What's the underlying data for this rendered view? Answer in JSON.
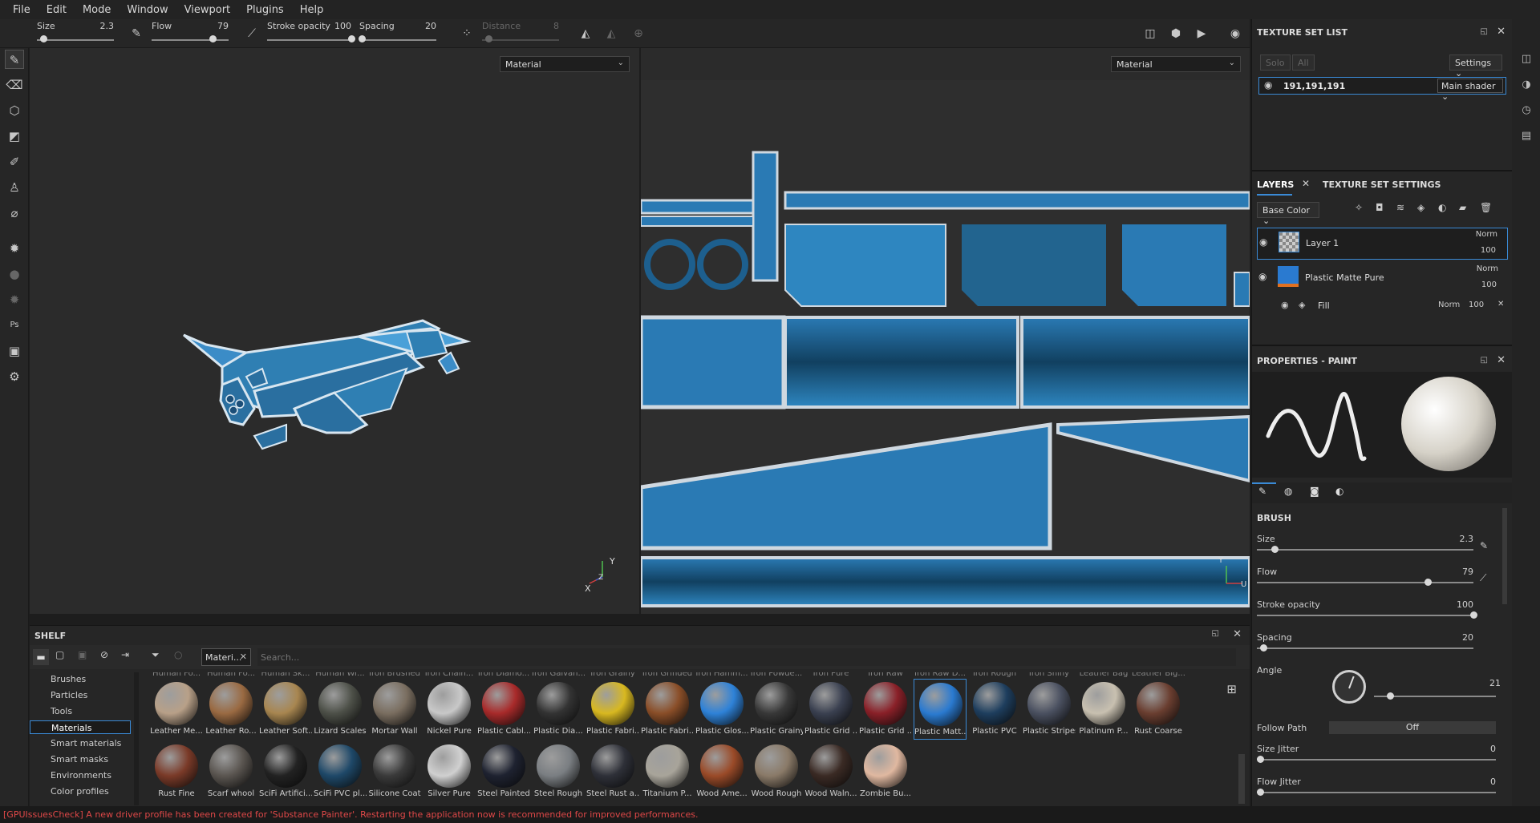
{
  "menu": [
    "File",
    "Edit",
    "Mode",
    "Window",
    "Viewport",
    "Plugins",
    "Help"
  ],
  "toolbar": {
    "size": {
      "label": "Size",
      "value": "2.3",
      "level": 0.08
    },
    "flow": {
      "label": "Flow",
      "value": "79",
      "level": 0.79
    },
    "stroke_opacity": {
      "label": "Stroke opacity",
      "value": "100",
      "level": 1.0
    },
    "spacing": {
      "label": "Spacing",
      "value": "20",
      "level": 0.03
    },
    "distance": {
      "label": "Distance",
      "value": "8",
      "level": 0.08
    }
  },
  "viewport3d": {
    "channel": "Material",
    "gizmo": {
      "y": "Y",
      "z": "Z",
      "x": "X"
    }
  },
  "viewport2d": {
    "channel": "Material",
    "gizmo": {
      "y": "Y",
      "x": "U"
    }
  },
  "shelf": {
    "title": "SHELF",
    "filter_tag": "Materi...",
    "search_placeholder": "Search...",
    "categories": [
      "Brushes",
      "Particles",
      "Tools",
      "Materials",
      "Smart materials",
      "Smart masks",
      "Environments",
      "Color profiles"
    ],
    "active_category": "Materials",
    "top_partial": [
      "Human Fo...",
      "Human Fo...",
      "Human Sk...",
      "Human Wr...",
      "Iron Brushed",
      "Iron Chain...",
      "Iron Diamo...",
      "Iron Galvan...",
      "Iron Grainy",
      "Iron Grinded",
      "Iron Hamm...",
      "Iron Powde...",
      "Iron Pure",
      "Iron Raw",
      "Iron Raw D...",
      "Iron Rough",
      "Iron Shiny",
      "Leather Bag",
      "Leather Big..."
    ],
    "row1": [
      {
        "name": "Leather Me...",
        "color": "#b8a088"
      },
      {
        "name": "Leather Ro...",
        "color": "#9a6a42"
      },
      {
        "name": "Leather Soft...",
        "color": "#a88650"
      },
      {
        "name": "Lizard Scales",
        "color": "#4d5048"
      },
      {
        "name": "Mortar Wall",
        "color": "#7a6e60"
      },
      {
        "name": "Nickel Pure",
        "color": "#c8c8c8"
      },
      {
        "name": "Plastic Cabl...",
        "color": "#a82a2a"
      },
      {
        "name": "Plastic Dia...",
        "color": "#333333"
      },
      {
        "name": "Plastic Fabri...",
        "color": "#d8b820"
      },
      {
        "name": "Plastic Fabri...",
        "color": "#8a4e28"
      },
      {
        "name": "Plastic Glos...",
        "color": "#2e82d8"
      },
      {
        "name": "Plastic Grainy",
        "color": "#383838"
      },
      {
        "name": "Plastic Grid ...",
        "color": "#3a4050"
      },
      {
        "name": "Plastic Grid ...",
        "color": "#8a2028"
      },
      {
        "name": "Plastic Matt...",
        "color": "#2a7ad0"
      },
      {
        "name": "Plastic PVC",
        "color": "#1e3e5e"
      },
      {
        "name": "Plastic Stripes",
        "color": "#4a5060"
      },
      {
        "name": "Platinum P...",
        "color": "#c8c0b0"
      },
      {
        "name": "Rust Coarse",
        "color": "#6a3e30"
      }
    ],
    "row2": [
      {
        "name": "Rust Fine",
        "color": "#7a3a28"
      },
      {
        "name": "Scarf whool",
        "color": "#5a5550"
      },
      {
        "name": "SciFi Artifici...",
        "color": "#222222"
      },
      {
        "name": "SciFi PVC pl...",
        "color": "#1e4868"
      },
      {
        "name": "Silicone Coat",
        "color": "#3a3a3a"
      },
      {
        "name": "Silver Pure",
        "color": "#d0d0d0"
      },
      {
        "name": "Steel Painted",
        "color": "#1e2230"
      },
      {
        "name": "Steel Rough",
        "color": "#7a7e82"
      },
      {
        "name": "Steel Rust a...",
        "color": "#2e3038"
      },
      {
        "name": "Titanium P...",
        "color": "#a8a49a"
      },
      {
        "name": "Wood Ame...",
        "color": "#9a4a28"
      },
      {
        "name": "Wood Rough",
        "color": "#8a7a68"
      },
      {
        "name": "Wood Waln...",
        "color": "#3a2a24"
      },
      {
        "name": "Zombie Bu...",
        "color": "#e0b8a0"
      }
    ],
    "selected": "Plastic Matt..."
  },
  "status": "[GPUIssuesCheck] A new driver profile has been created for 'Substance Painter'. Restarting the application now is recommended for improved performances.",
  "texture_set_list": {
    "title": "TEXTURE SET LIST",
    "solo": "Solo",
    "all": "All",
    "settings": "Settings",
    "set_name": "191,191,191",
    "shader": "Main shader"
  },
  "layers": {
    "tab1": "LAYERS",
    "tab2": "TEXTURE SET SETTINGS",
    "channel": "Base Color",
    "items": [
      {
        "name": "Layer 1",
        "blend": "Norm",
        "opacity": "100"
      },
      {
        "name": "Plastic Matte Pure",
        "blend": "Norm",
        "opacity": "100"
      }
    ],
    "fill": {
      "name": "Fill",
      "blend": "Norm",
      "opacity": "100"
    }
  },
  "properties": {
    "title": "PROPERTIES - PAINT",
    "section": "BRUSH",
    "rows": [
      {
        "label": "Size",
        "value": "2.3",
        "level": 0.08
      },
      {
        "label": "Flow",
        "value": "79",
        "level": 0.79
      },
      {
        "label": "Stroke opacity",
        "value": "100",
        "level": 1.0
      },
      {
        "label": "Spacing",
        "value": "20",
        "level": 0.03
      }
    ],
    "angle": {
      "label": "Angle",
      "value": "21"
    },
    "follow_path": {
      "label": "Follow Path",
      "value": "Off"
    },
    "size_jitter": {
      "label": "Size Jitter",
      "value": "0"
    },
    "flow_jitter": {
      "label": "Flow Jitter",
      "value": "0"
    }
  },
  "colors": {
    "accent": "#3a8ad6",
    "model_blue": "#2f7fb3",
    "status_error": "#e04848"
  }
}
